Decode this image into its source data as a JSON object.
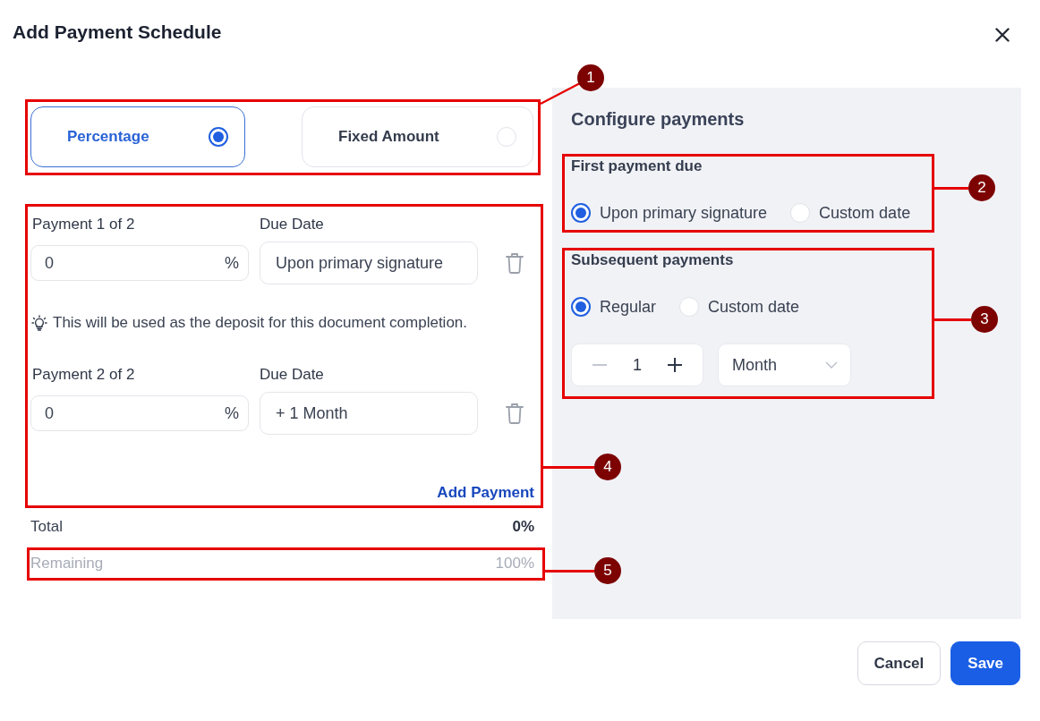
{
  "dialog": {
    "title": "Add Payment Schedule"
  },
  "amount_type": {
    "callout": "1",
    "options": [
      {
        "label": "Percentage",
        "selected": true
      },
      {
        "label": "Fixed Amount",
        "selected": false
      }
    ]
  },
  "payments": {
    "callout": "4",
    "items": [
      {
        "label": "Payment 1 of 2",
        "amount": "0",
        "unit": "%",
        "due_label": "Due Date",
        "due_value": "Upon primary signature",
        "note": "This will be used as the deposit for this document completion."
      },
      {
        "label": "Payment 2 of 2",
        "amount": "0",
        "unit": "%",
        "due_label": "Due Date",
        "due_value": "+ 1 Month"
      }
    ],
    "add_link": "Add Payment"
  },
  "total": {
    "label": "Total",
    "value": "0%"
  },
  "remaining": {
    "callout": "5",
    "label": "Remaining",
    "value": "100%"
  },
  "configure": {
    "title": "Configure payments",
    "first_payment": {
      "callout": "2",
      "label": "First payment due",
      "options": [
        {
          "label": "Upon primary signature",
          "selected": true
        },
        {
          "label": "Custom date",
          "selected": false
        }
      ]
    },
    "subsequent_payments": {
      "callout": "3",
      "label": "Subsequent payments",
      "options": [
        {
          "label": "Regular",
          "selected": true
        },
        {
          "label": "Custom date",
          "selected": false
        }
      ],
      "interval": {
        "value": "1",
        "decrement_disabled": true,
        "unit": "Month"
      }
    }
  },
  "buttons": [
    {
      "label": "Cancel",
      "kind": "secondary"
    },
    {
      "label": "Save",
      "kind": "primary"
    }
  ]
}
